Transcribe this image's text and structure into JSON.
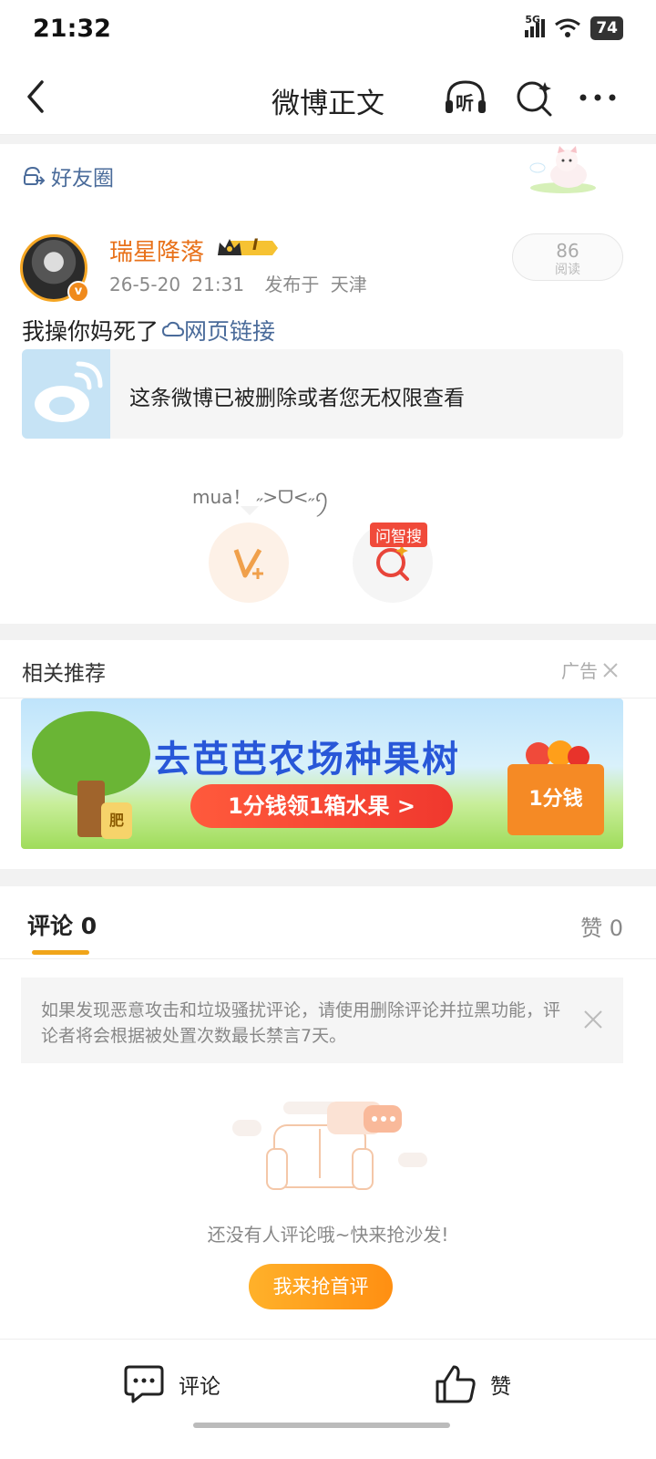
{
  "status_bar": {
    "time": "21:32",
    "network": "5G",
    "battery": "74"
  },
  "header": {
    "title": "微博正文",
    "listen_label": "听"
  },
  "post": {
    "visibility": "好友圈",
    "username": "瑞星降落",
    "level_badge": "I",
    "timestamp": "26-5-20 21:31",
    "location": "发布于 天津",
    "read_count": "86",
    "read_label": "阅读",
    "text": "我操你妈死了",
    "link_label": "网页链接",
    "card_text": "这条微博已被删除或者您无权限查看",
    "bubble_text": "mua！ ˶>ᗜ<˶ꪆ",
    "search_badge": "问智搜"
  },
  "recommend": {
    "title": "相关推荐",
    "ad_label": "广告",
    "banner_title": "去芭芭农场种果树",
    "banner_button": "1分钱领1箱水果 >",
    "banner_corner": "1分钱",
    "banner_tag": "肥"
  },
  "tabs": {
    "comment": "评论 0",
    "like": "赞 0"
  },
  "notice": "如果发现恶意攻击和垃圾骚扰评论，请使用删除评论并拉黑功能，评论者将会根据被处置次数最长禁言7天。",
  "empty_state": {
    "text": "还没有人评论哦~快来抢沙发!",
    "button": "我来抢首评"
  },
  "bottom_bar": {
    "comment": "评论",
    "like": "赞"
  },
  "colors": {
    "accent_orange": "#f0a51a",
    "username": "#e8711a",
    "link_blue": "#4a6b9a"
  }
}
